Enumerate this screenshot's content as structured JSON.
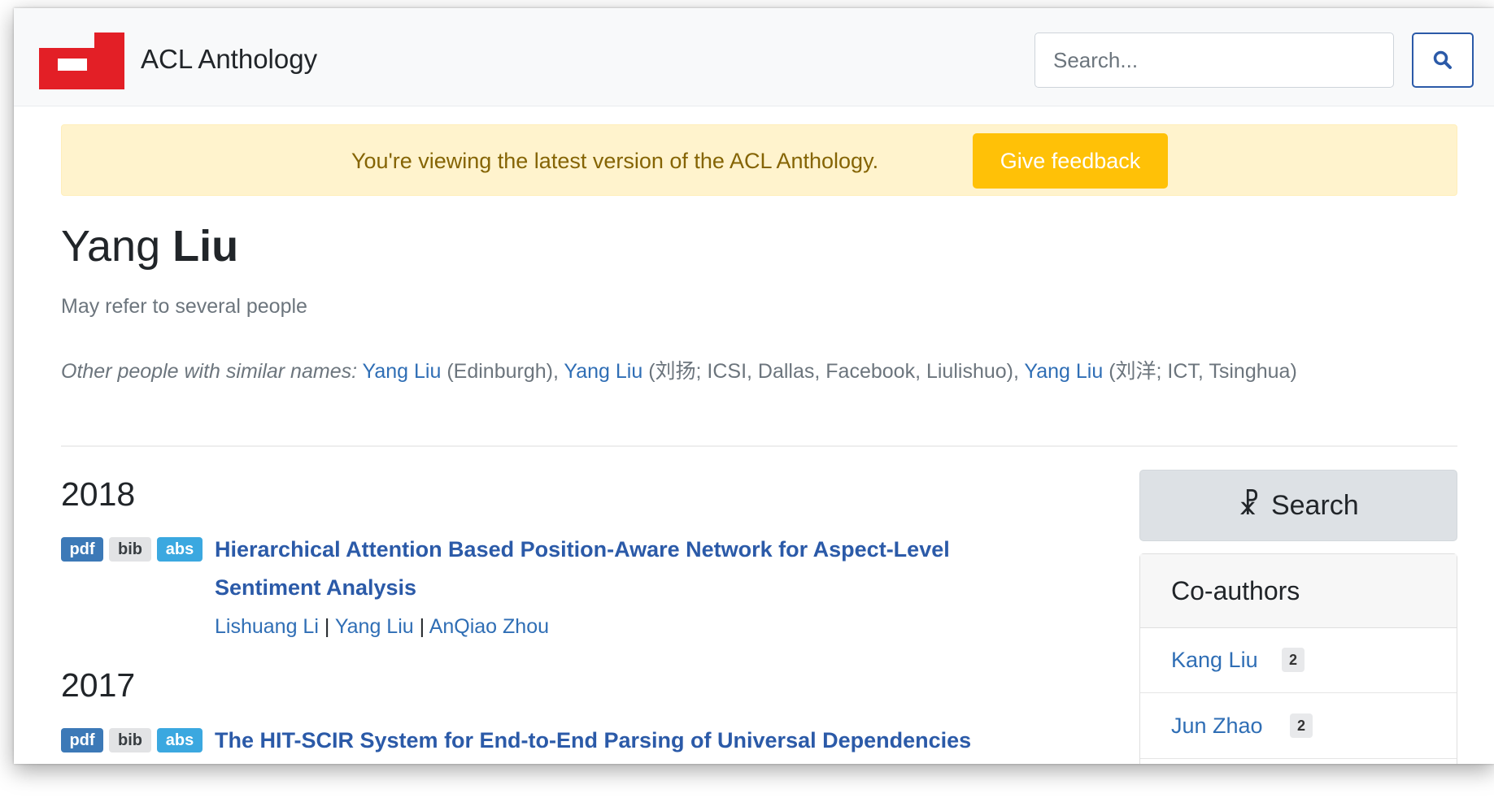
{
  "navbar": {
    "brand": "ACL Anthology",
    "search_placeholder": "Search..."
  },
  "alert": {
    "message": "You're viewing the latest version of the ACL Anthology.",
    "button": "Give feedback"
  },
  "person": {
    "first_name": "Yang",
    "last_name": "Liu",
    "note": "May refer to several people",
    "similar_label": "Other people with similar names:",
    "similar": [
      {
        "name": "Yang Liu",
        "detail": " (Edinburgh), "
      },
      {
        "name": "Yang Liu",
        "detail": " (刘扬; ICSI, Dallas, Facebook, Liulishuo), "
      },
      {
        "name": "Yang Liu",
        "detail": " (刘洋; ICT, Tsinghua)"
      }
    ]
  },
  "publications": [
    {
      "year": "2018",
      "badges": [
        "pdf",
        "bib",
        "abs"
      ],
      "title_line1": "Hierarchical Attention Based Position-Aware Network for Aspect-Level",
      "title_line2": "Sentiment Analysis",
      "authors": [
        "Lishuang Li",
        "Yang Liu",
        "AnQiao Zhou"
      ],
      "author_sep": " | "
    },
    {
      "year": "2017",
      "badges": [
        "pdf",
        "bib",
        "abs"
      ],
      "title_line1": "The HIT-SCIR System for End-to-End Parsing of Universal Dependencies"
    }
  ],
  "sidebar": {
    "search_label": "Search",
    "coauthors_title": "Co-authors",
    "coauthors": [
      {
        "name": "Kang Liu",
        "count": "2"
      },
      {
        "name": "Jun Zhao",
        "count": "2"
      }
    ]
  },
  "colors": {
    "link": "#2b5aa8",
    "alert_bg": "#fff3cd",
    "feedback_btn": "#ffc107",
    "logo_red": "#e31f26"
  }
}
